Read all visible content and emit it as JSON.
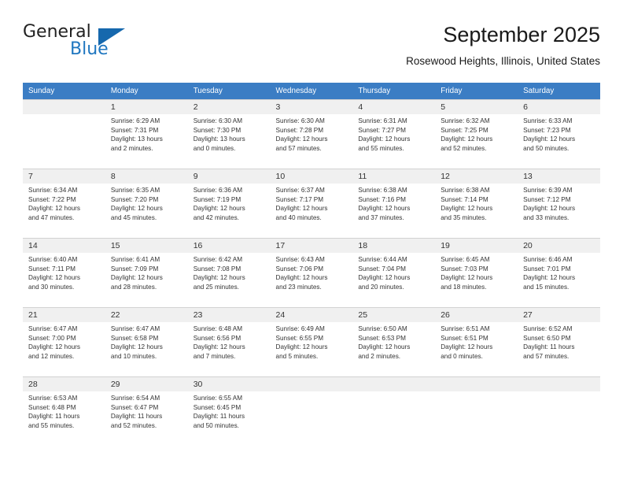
{
  "brand": {
    "name_top": "General",
    "name_bottom": "Blue",
    "triangle_color": "#1668ad",
    "blue_color": "#2077c0"
  },
  "header": {
    "title": "September 2025",
    "subtitle": "Rosewood Heights, Illinois, United States",
    "header_bg": "#3b7dc4"
  },
  "weekday_headers": [
    "Sunday",
    "Monday",
    "Tuesday",
    "Wednesday",
    "Thursday",
    "Friday",
    "Saturday"
  ],
  "labels": {
    "sunrise_prefix": "Sunrise:",
    "sunset_prefix": "Sunset:",
    "daylight_prefix": "Daylight:"
  },
  "weeks": [
    [
      {
        "day": "",
        "empty": true
      },
      {
        "day": "1",
        "sunrise": "Sunrise: 6:29 AM",
        "sunset": "Sunset: 7:31 PM",
        "daylight_line1": "Daylight: 13 hours",
        "daylight_line2": "and 2 minutes."
      },
      {
        "day": "2",
        "sunrise": "Sunrise: 6:30 AM",
        "sunset": "Sunset: 7:30 PM",
        "daylight_line1": "Daylight: 13 hours",
        "daylight_line2": "and 0 minutes."
      },
      {
        "day": "3",
        "sunrise": "Sunrise: 6:30 AM",
        "sunset": "Sunset: 7:28 PM",
        "daylight_line1": "Daylight: 12 hours",
        "daylight_line2": "and 57 minutes."
      },
      {
        "day": "4",
        "sunrise": "Sunrise: 6:31 AM",
        "sunset": "Sunset: 7:27 PM",
        "daylight_line1": "Daylight: 12 hours",
        "daylight_line2": "and 55 minutes."
      },
      {
        "day": "5",
        "sunrise": "Sunrise: 6:32 AM",
        "sunset": "Sunset: 7:25 PM",
        "daylight_line1": "Daylight: 12 hours",
        "daylight_line2": "and 52 minutes."
      },
      {
        "day": "6",
        "sunrise": "Sunrise: 6:33 AM",
        "sunset": "Sunset: 7:23 PM",
        "daylight_line1": "Daylight: 12 hours",
        "daylight_line2": "and 50 minutes."
      }
    ],
    [
      {
        "day": "7",
        "sunrise": "Sunrise: 6:34 AM",
        "sunset": "Sunset: 7:22 PM",
        "daylight_line1": "Daylight: 12 hours",
        "daylight_line2": "and 47 minutes."
      },
      {
        "day": "8",
        "sunrise": "Sunrise: 6:35 AM",
        "sunset": "Sunset: 7:20 PM",
        "daylight_line1": "Daylight: 12 hours",
        "daylight_line2": "and 45 minutes."
      },
      {
        "day": "9",
        "sunrise": "Sunrise: 6:36 AM",
        "sunset": "Sunset: 7:19 PM",
        "daylight_line1": "Daylight: 12 hours",
        "daylight_line2": "and 42 minutes."
      },
      {
        "day": "10",
        "sunrise": "Sunrise: 6:37 AM",
        "sunset": "Sunset: 7:17 PM",
        "daylight_line1": "Daylight: 12 hours",
        "daylight_line2": "and 40 minutes."
      },
      {
        "day": "11",
        "sunrise": "Sunrise: 6:38 AM",
        "sunset": "Sunset: 7:16 PM",
        "daylight_line1": "Daylight: 12 hours",
        "daylight_line2": "and 37 minutes."
      },
      {
        "day": "12",
        "sunrise": "Sunrise: 6:38 AM",
        "sunset": "Sunset: 7:14 PM",
        "daylight_line1": "Daylight: 12 hours",
        "daylight_line2": "and 35 minutes."
      },
      {
        "day": "13",
        "sunrise": "Sunrise: 6:39 AM",
        "sunset": "Sunset: 7:12 PM",
        "daylight_line1": "Daylight: 12 hours",
        "daylight_line2": "and 33 minutes."
      }
    ],
    [
      {
        "day": "14",
        "sunrise": "Sunrise: 6:40 AM",
        "sunset": "Sunset: 7:11 PM",
        "daylight_line1": "Daylight: 12 hours",
        "daylight_line2": "and 30 minutes."
      },
      {
        "day": "15",
        "sunrise": "Sunrise: 6:41 AM",
        "sunset": "Sunset: 7:09 PM",
        "daylight_line1": "Daylight: 12 hours",
        "daylight_line2": "and 28 minutes."
      },
      {
        "day": "16",
        "sunrise": "Sunrise: 6:42 AM",
        "sunset": "Sunset: 7:08 PM",
        "daylight_line1": "Daylight: 12 hours",
        "daylight_line2": "and 25 minutes."
      },
      {
        "day": "17",
        "sunrise": "Sunrise: 6:43 AM",
        "sunset": "Sunset: 7:06 PM",
        "daylight_line1": "Daylight: 12 hours",
        "daylight_line2": "and 23 minutes."
      },
      {
        "day": "18",
        "sunrise": "Sunrise: 6:44 AM",
        "sunset": "Sunset: 7:04 PM",
        "daylight_line1": "Daylight: 12 hours",
        "daylight_line2": "and 20 minutes."
      },
      {
        "day": "19",
        "sunrise": "Sunrise: 6:45 AM",
        "sunset": "Sunset: 7:03 PM",
        "daylight_line1": "Daylight: 12 hours",
        "daylight_line2": "and 18 minutes."
      },
      {
        "day": "20",
        "sunrise": "Sunrise: 6:46 AM",
        "sunset": "Sunset: 7:01 PM",
        "daylight_line1": "Daylight: 12 hours",
        "daylight_line2": "and 15 minutes."
      }
    ],
    [
      {
        "day": "21",
        "sunrise": "Sunrise: 6:47 AM",
        "sunset": "Sunset: 7:00 PM",
        "daylight_line1": "Daylight: 12 hours",
        "daylight_line2": "and 12 minutes."
      },
      {
        "day": "22",
        "sunrise": "Sunrise: 6:47 AM",
        "sunset": "Sunset: 6:58 PM",
        "daylight_line1": "Daylight: 12 hours",
        "daylight_line2": "and 10 minutes."
      },
      {
        "day": "23",
        "sunrise": "Sunrise: 6:48 AM",
        "sunset": "Sunset: 6:56 PM",
        "daylight_line1": "Daylight: 12 hours",
        "daylight_line2": "and 7 minutes."
      },
      {
        "day": "24",
        "sunrise": "Sunrise: 6:49 AM",
        "sunset": "Sunset: 6:55 PM",
        "daylight_line1": "Daylight: 12 hours",
        "daylight_line2": "and 5 minutes."
      },
      {
        "day": "25",
        "sunrise": "Sunrise: 6:50 AM",
        "sunset": "Sunset: 6:53 PM",
        "daylight_line1": "Daylight: 12 hours",
        "daylight_line2": "and 2 minutes."
      },
      {
        "day": "26",
        "sunrise": "Sunrise: 6:51 AM",
        "sunset": "Sunset: 6:51 PM",
        "daylight_line1": "Daylight: 12 hours",
        "daylight_line2": "and 0 minutes."
      },
      {
        "day": "27",
        "sunrise": "Sunrise: 6:52 AM",
        "sunset": "Sunset: 6:50 PM",
        "daylight_line1": "Daylight: 11 hours",
        "daylight_line2": "and 57 minutes."
      }
    ],
    [
      {
        "day": "28",
        "sunrise": "Sunrise: 6:53 AM",
        "sunset": "Sunset: 6:48 PM",
        "daylight_line1": "Daylight: 11 hours",
        "daylight_line2": "and 55 minutes."
      },
      {
        "day": "29",
        "sunrise": "Sunrise: 6:54 AM",
        "sunset": "Sunset: 6:47 PM",
        "daylight_line1": "Daylight: 11 hours",
        "daylight_line2": "and 52 minutes."
      },
      {
        "day": "30",
        "sunrise": "Sunrise: 6:55 AM",
        "sunset": "Sunset: 6:45 PM",
        "daylight_line1": "Daylight: 11 hours",
        "daylight_line2": "and 50 minutes."
      },
      {
        "day": "",
        "empty": true
      },
      {
        "day": "",
        "empty": true
      },
      {
        "day": "",
        "empty": true
      },
      {
        "day": "",
        "empty": true
      }
    ]
  ]
}
